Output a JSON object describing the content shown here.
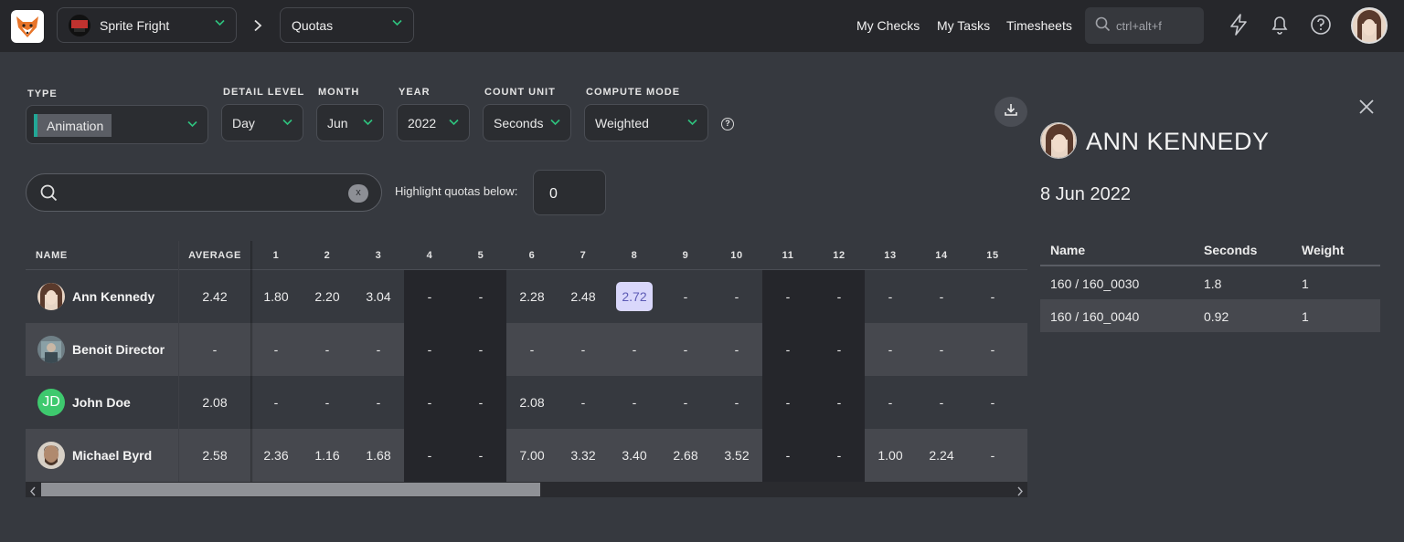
{
  "topbar": {
    "project": "Sprite Fright",
    "section": "Quotas",
    "nav": [
      "My Checks",
      "My Tasks",
      "Timesheets"
    ],
    "search_placeholder": "ctrl+alt+f"
  },
  "filters": {
    "type": {
      "label": "TYPE",
      "value": "Animation"
    },
    "detail_level": {
      "label": "DETAIL LEVEL",
      "value": "Day"
    },
    "month": {
      "label": "MONTH",
      "value": "Jun"
    },
    "year": {
      "label": "YEAR",
      "value": "2022"
    },
    "count_unit": {
      "label": "COUNT UNIT",
      "value": "Seconds"
    },
    "compute_mode": {
      "label": "COMPUTE MODE",
      "value": "Weighted"
    }
  },
  "search": {
    "value": "",
    "clear": "x"
  },
  "highlight": {
    "label": "Highlight quotas below:",
    "value": "0"
  },
  "table": {
    "headers": {
      "name": "NAME",
      "average": "AVERAGE",
      "days": [
        "1",
        "2",
        "3",
        "4",
        "5",
        "6",
        "7",
        "8",
        "9",
        "10",
        "11",
        "12",
        "13",
        "14",
        "15"
      ]
    },
    "weekend_days": [
      4,
      5,
      11,
      12
    ],
    "rows": [
      {
        "name": "Ann Kennedy",
        "average": "2.42",
        "days": [
          "1.80",
          "2.20",
          "3.04",
          "-",
          "-",
          "2.28",
          "2.48",
          "2.72",
          "-",
          "-",
          "-",
          "-",
          "-",
          "-",
          "-"
        ]
      },
      {
        "name": "Benoit Director",
        "average": "-",
        "days": [
          "-",
          "-",
          "-",
          "-",
          "-",
          "-",
          "-",
          "-",
          "-",
          "-",
          "-",
          "-",
          "-",
          "-",
          "-"
        ]
      },
      {
        "name": "John Doe",
        "initials": "JD",
        "average": "2.08",
        "days": [
          "-",
          "-",
          "-",
          "-",
          "-",
          "2.08",
          "-",
          "-",
          "-",
          "-",
          "-",
          "-",
          "-",
          "-",
          "-"
        ]
      },
      {
        "name": "Michael Byrd",
        "average": "2.58",
        "days": [
          "2.36",
          "1.16",
          "1.68",
          "-",
          "-",
          "7.00",
          "3.32",
          "3.40",
          "2.68",
          "3.52",
          "-",
          "-",
          "1.00",
          "2.24",
          "-"
        ]
      }
    ],
    "highlighted": {
      "row": 0,
      "day": 8
    }
  },
  "detail": {
    "name": "ANN KENNEDY",
    "date": "8 Jun 2022",
    "headers": [
      "Name",
      "Seconds",
      "Weight"
    ],
    "rows": [
      [
        "160 / 160_0030",
        "1.8",
        "1"
      ],
      [
        "160 / 160_0040",
        "0.92",
        "1"
      ]
    ]
  },
  "colors": {
    "accent": "#2ec27e",
    "type_tag_border": "#22a796",
    "highlight_cell_bg": "#d9d7fb",
    "jd_avatar": "#3ec96e"
  },
  "icons": [
    "kitsu-fox-logo",
    "chevron-down-icon",
    "chevron-right-icon",
    "search-icon",
    "lightning-icon",
    "bell-icon",
    "help-icon",
    "download-icon",
    "close-icon"
  ]
}
